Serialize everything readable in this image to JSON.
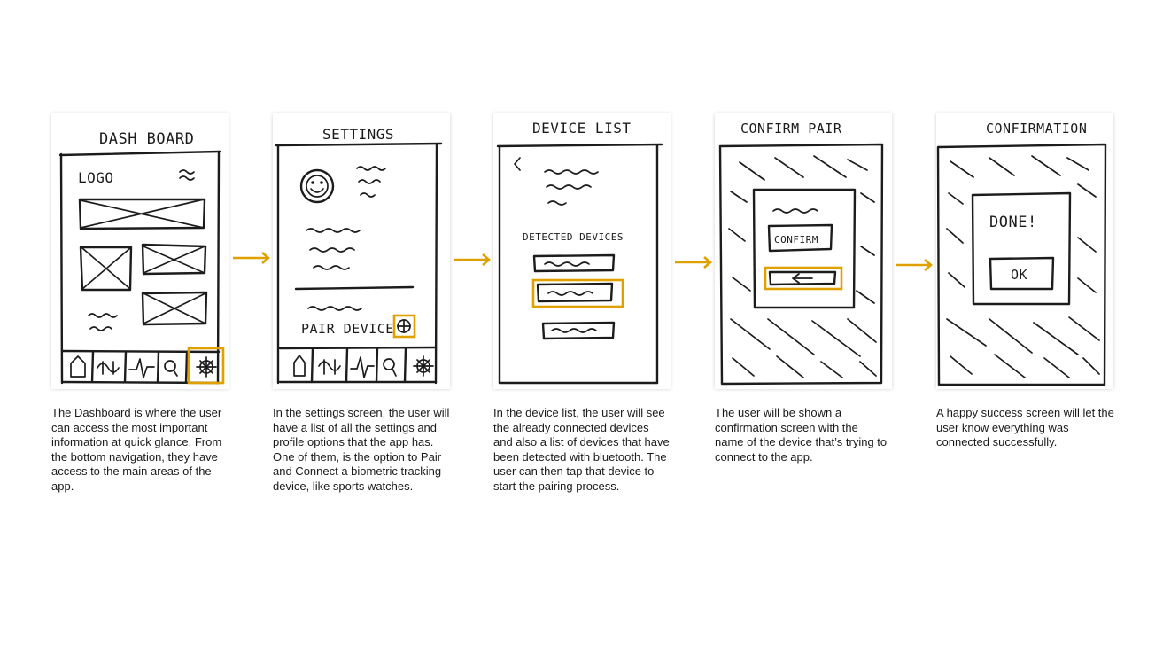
{
  "accent_color": "#e0a100",
  "screens": [
    {
      "title": "DASH BOARD",
      "logo": "LOGO",
      "caption": "The Dashboard is where the user can access the most important information at quick glance. From the bottom navigation, they have access to the main areas of the app."
    },
    {
      "title": "SETTINGS",
      "action": "PAIR DEVICE",
      "caption": "In the settings screen, the user will have a list of all the settings and profile options that the app has. One of them, is the option to Pair and Connect a biometric tracking device, like sports watches."
    },
    {
      "title": "DEVICE LIST",
      "section": "DETECTED DEVICES",
      "caption": "In the device list, the user will see the already connected devices and also a list of devices that have been detected with bluetooth. The user can then tap that device to start the pairing process."
    },
    {
      "title": "CONFIRM PAIR",
      "button": "CONFIRM",
      "caption": "The user will be shown a confirmation screen with the name of the device that’s trying to connect to the app."
    },
    {
      "title": "CONFIRMATION",
      "message": "DONE!",
      "button": "OK",
      "caption": "A happy success screen will let the user know everything was connected successfully."
    }
  ],
  "icons": {
    "nav": [
      "home-icon",
      "devices-icon",
      "heartbeat-icon",
      "search-icon",
      "settings-icon"
    ],
    "arrow": "right-arrow-icon"
  }
}
